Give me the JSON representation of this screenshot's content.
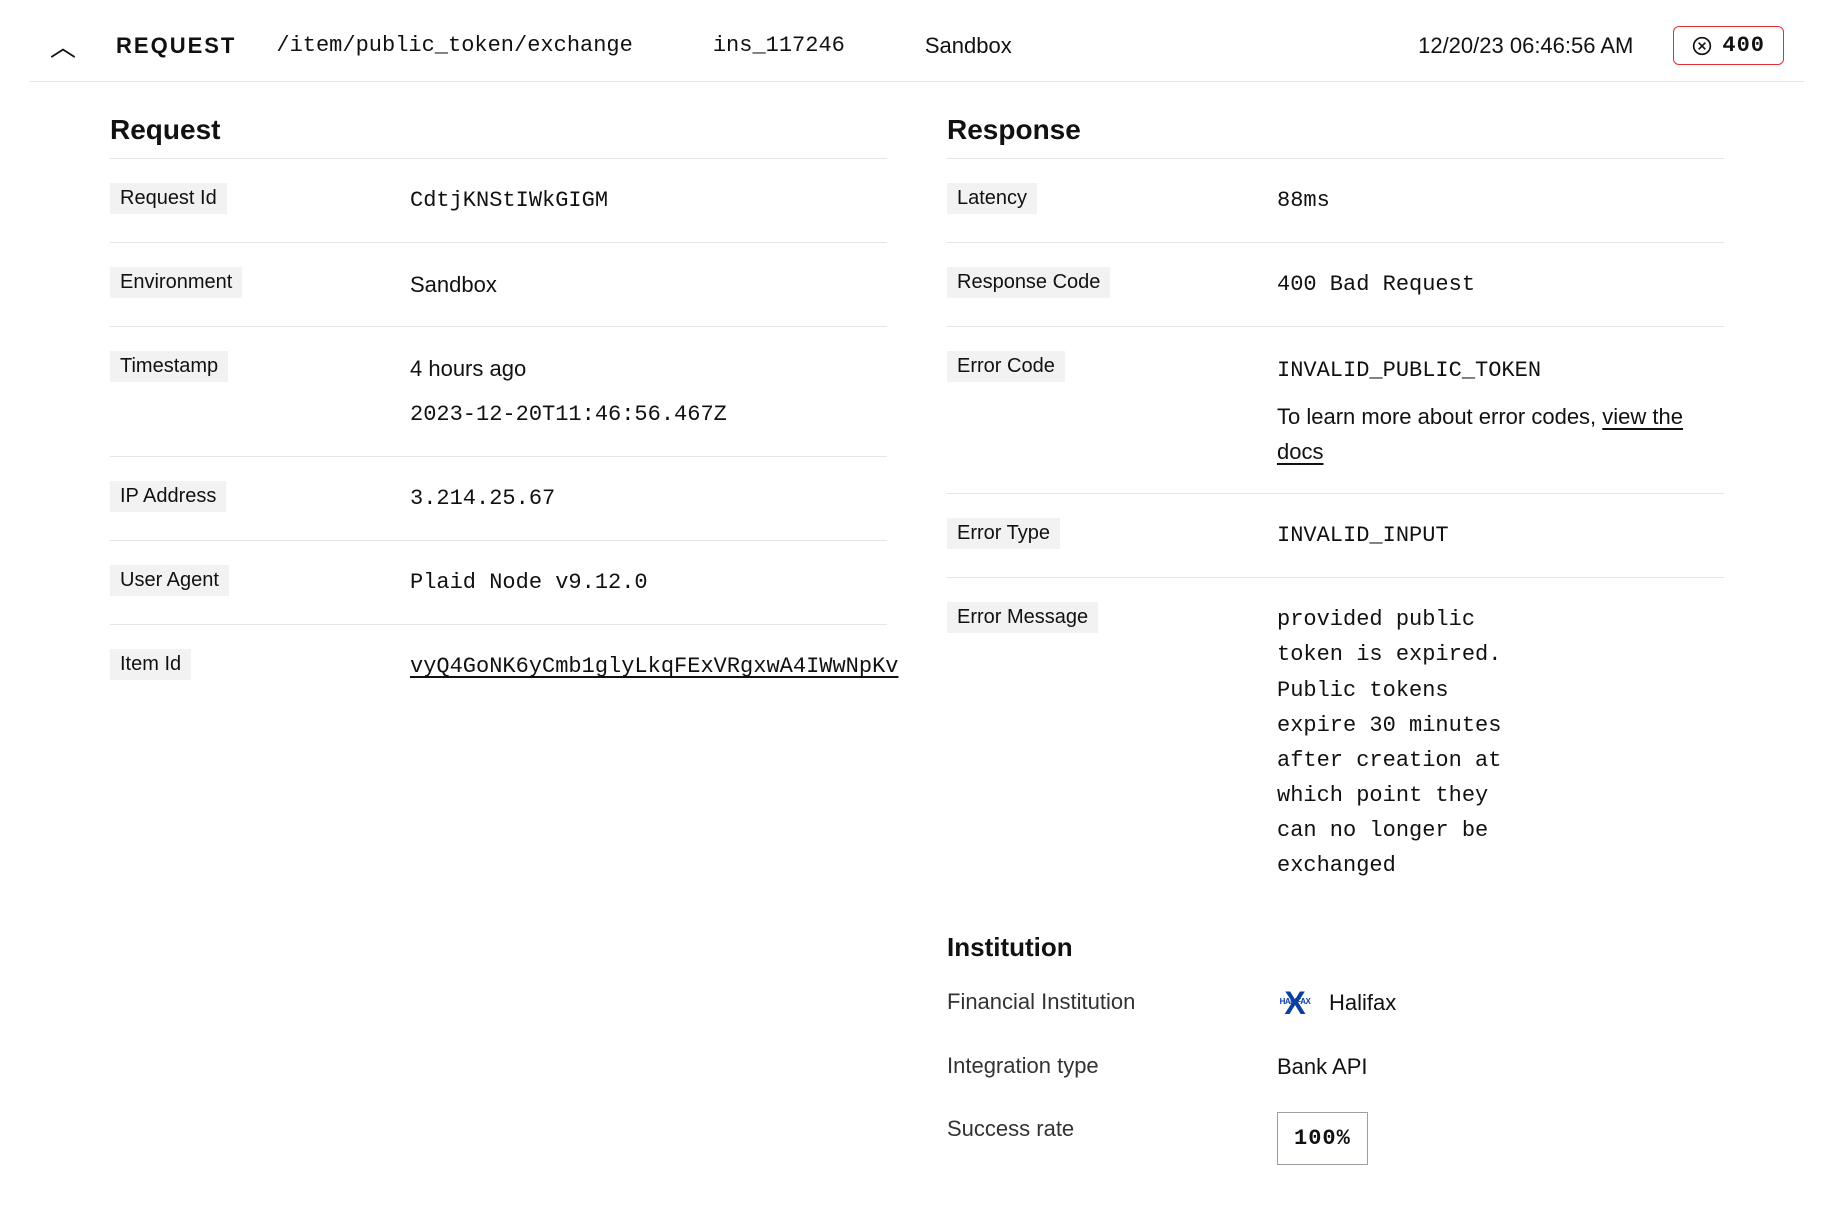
{
  "header": {
    "label": "REQUEST",
    "path": "/item/public_token/exchange",
    "institution_id": "ins_117246",
    "environment": "Sandbox",
    "timestamp": "12/20/23 06:46:56 AM",
    "status_code": "400"
  },
  "request": {
    "heading": "Request",
    "id_label": "Request Id",
    "id_value": "CdtjKNStIWkGIGM",
    "env_label": "Environment",
    "env_value": "Sandbox",
    "ts_label": "Timestamp",
    "ts_relative": "4 hours ago",
    "ts_iso": "2023-12-20T11:46:56.467Z",
    "ip_label": "IP Address",
    "ip_value": "3.214.25.67",
    "ua_label": "User Agent",
    "ua_value": "Plaid Node v9.12.0",
    "item_id_label": "Item Id",
    "item_id_value": "vyQ4GoNK6yCmb1glyLkqFExVRgxwA4IWwNpKv"
  },
  "response": {
    "heading": "Response",
    "latency_label": "Latency",
    "latency_value": "88ms",
    "code_label": "Response Code",
    "code_value": "400 Bad Request",
    "err_code_label": "Error Code",
    "err_code_value": "INVALID_PUBLIC_TOKEN",
    "err_code_help_prefix": "To learn more about error codes, ",
    "err_code_help_link": "view the docs",
    "err_type_label": "Error Type",
    "err_type_value": "INVALID_INPUT",
    "err_msg_label": "Error Message",
    "err_msg_value": "provided public token is expired. Public tokens expire 30 minutes after creation at which point they can no longer be exchanged"
  },
  "institution": {
    "heading": "Institution",
    "fi_label": "Financial Institution",
    "fi_name": "Halifax",
    "integration_label": "Integration type",
    "integration_value": "Bank API",
    "success_label": "Success rate",
    "success_value": "100%"
  }
}
